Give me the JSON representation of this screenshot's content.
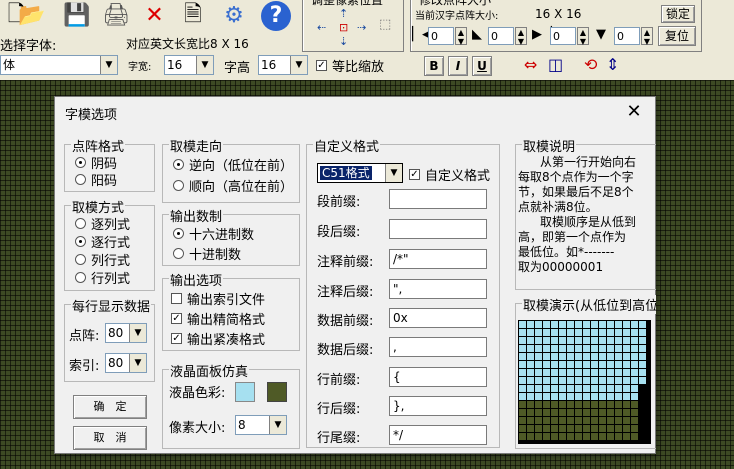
{
  "toolbar": {
    "icons": [
      "new-icon",
      "open-folder-icon",
      "save-icon",
      "print-icon",
      "delete-icon",
      "document-icon",
      "gear-icon",
      "help-icon"
    ],
    "pixel_pos_title": "调整像素位置",
    "resize_title": "修改点阵大小",
    "current_size_label": "当前汉字点阵大小:",
    "current_size_value": "16 X 16",
    "confirm_button": "锁定",
    "reset_button": "复位",
    "spin1": "0",
    "spin2": "0",
    "spin3": "0",
    "spin4": "0",
    "font_select_label": "选择字体:",
    "ratio_label": "对应英文长宽比8 X 16",
    "font_value": "体",
    "width_label": "字宽:",
    "width_value": "16",
    "height_label": "字高",
    "height_value": "16",
    "equal_ratio_label": "等比缩放",
    "bold_button": "B",
    "italic_button": "I",
    "underline_button": "U"
  },
  "dialog": {
    "title": "字模选项",
    "close": "✕",
    "dot_format": {
      "title": "点阵格式",
      "options": [
        "阴码",
        "阳码"
      ],
      "selected": 0
    },
    "scan_mode": {
      "title": "取模方式",
      "options": [
        "逐列式",
        "逐行式",
        "列行式",
        "行列式"
      ],
      "selected": 1
    },
    "per_line": {
      "title": "每行显示数据",
      "dot_label": "点阵:",
      "dot_value": "80",
      "index_label": "索引:",
      "index_value": "80"
    },
    "ok_button": "确　定",
    "cancel_button": "取　消",
    "direction": {
      "title": "取模走向",
      "options": [
        "逆向（低位在前）",
        "顺向（高位在前）"
      ],
      "selected": 0
    },
    "number_format": {
      "title": "输出数制",
      "options": [
        "十六进制数",
        "十进制数"
      ],
      "selected": 0
    },
    "output": {
      "title": "输出选项",
      "options": [
        {
          "label": "输出索引文件",
          "checked": false
        },
        {
          "label": "输出精简格式",
          "checked": true
        },
        {
          "label": "输出紧凑格式",
          "checked": true
        }
      ]
    },
    "lcd": {
      "title": "液晶面板仿真",
      "color_label": "液晶色彩:",
      "pixel_label": "像素大小:",
      "pixel_value": "8"
    },
    "custom": {
      "title": "自定义格式",
      "format_value": "C51格式",
      "custom_check_label": "自定义格式",
      "fields": [
        {
          "label": "段前缀:",
          "value": ""
        },
        {
          "label": "段后缀:",
          "value": ""
        },
        {
          "label": "注释前缀:",
          "value": "/*\""
        },
        {
          "label": "注释后缀:",
          "value": "\","
        },
        {
          "label": "数据前缀:",
          "value": "0x"
        },
        {
          "label": "数据后缀:",
          "value": ","
        },
        {
          "label": "行前缀:",
          "value": "{"
        },
        {
          "label": "行后缀:",
          "value": "},"
        },
        {
          "label": "行尾缀:",
          "value": "*/"
        }
      ]
    },
    "explanation": {
      "title": "取模说明",
      "lines": [
        "从第一行开始向右",
        "每取8个点作为一个字",
        "节，如果最后不足8个",
        "点就补满8位。",
        "取模顺序是从低到",
        "高，即第一个点作为",
        "最低位。如*-------",
        "取为00000001"
      ]
    },
    "demo": {
      "title": "取模演示(从低位到高位)"
    }
  },
  "colors": {
    "lcd_light": "#a6e0f0",
    "lcd_dark": "#4f5a26",
    "lcd_black": "#000000"
  }
}
